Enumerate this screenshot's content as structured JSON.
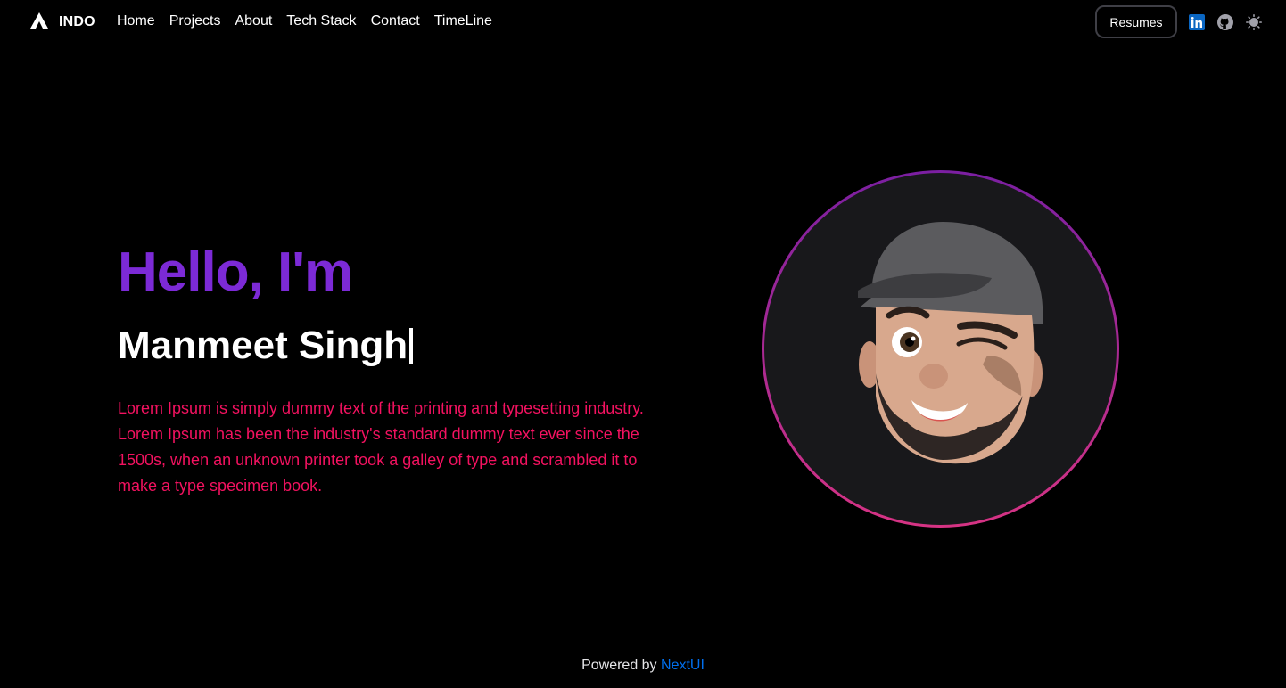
{
  "navbar": {
    "brand": "INDO",
    "links": [
      "Home",
      "Projects",
      "About",
      "Tech Stack",
      "Contact",
      "TimeLine"
    ],
    "resumes_label": "Resumes",
    "icons": [
      "linkedin-icon",
      "github-icon",
      "sun-icon"
    ]
  },
  "hero": {
    "greeting": "Hello, I'm",
    "name": "Manmeet Singh",
    "description": "Lorem Ipsum is simply dummy text of the printing and typesetting industry. Lorem Ipsum has been the industry's standard dummy text ever since the 1500s, when an unknown printer took a galley of type and scrambled it to make a type specimen book."
  },
  "footer": {
    "prefix": "Powered by",
    "link": "NextUI"
  },
  "colors": {
    "background": "#000000",
    "greeting": "#7c2ad6",
    "description": "#f31260",
    "link": "#006fee",
    "linkedin": "#0a66c2"
  }
}
